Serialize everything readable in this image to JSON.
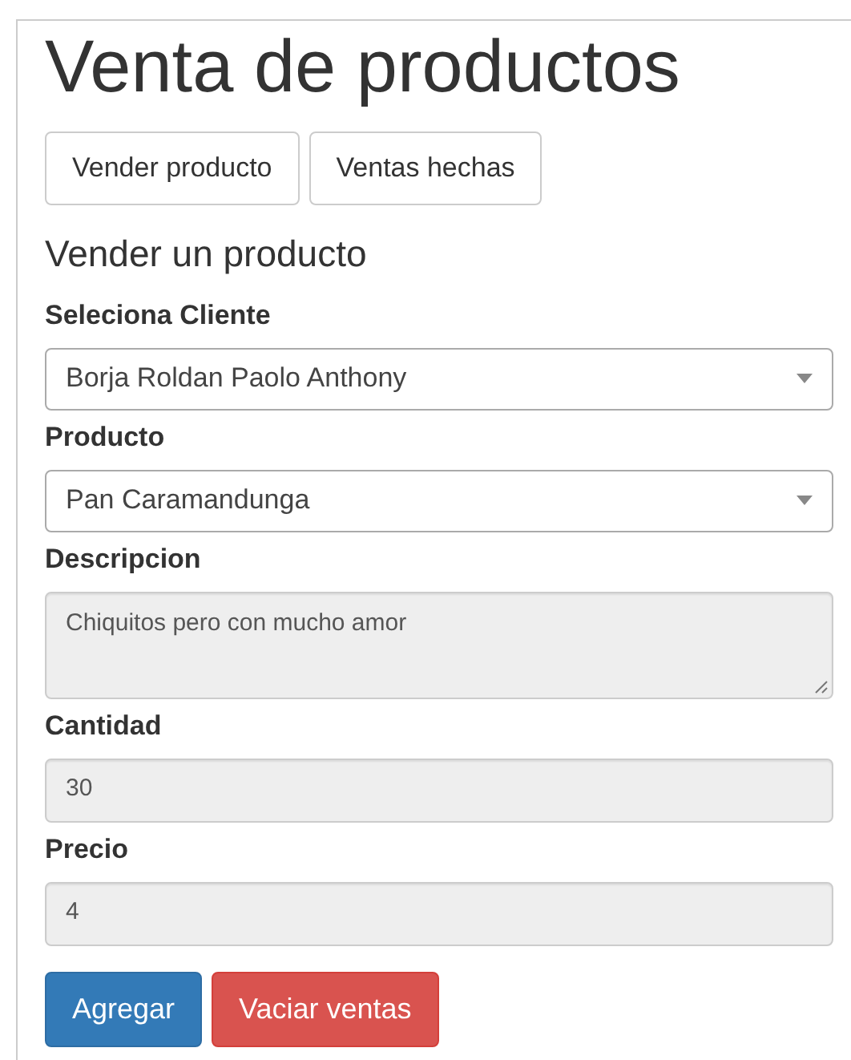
{
  "title": "Venta de productos",
  "nav_buttons": [
    "Vender producto",
    "Ventas hechas"
  ],
  "section_title": "Vender un producto",
  "fields": [
    {
      "label": "Seleciona Cliente",
      "kind": "select",
      "value": "Borja Roldan Paolo Anthony",
      "disabled": false
    },
    {
      "label": "Producto",
      "kind": "select",
      "value": "Pan Caramandunga",
      "disabled": false
    },
    {
      "label": "Descripcion",
      "kind": "textarea",
      "value": "Chiquitos pero con mucho amor",
      "disabled": true
    },
    {
      "label": "Cantidad",
      "kind": "input",
      "value": "30",
      "disabled": true
    },
    {
      "label": "Precio",
      "kind": "input",
      "value": "4",
      "disabled": true
    }
  ],
  "actions": [
    {
      "label": "Agregar",
      "kind": "primary"
    },
    {
      "label": "Vaciar ventas",
      "kind": "danger"
    }
  ]
}
